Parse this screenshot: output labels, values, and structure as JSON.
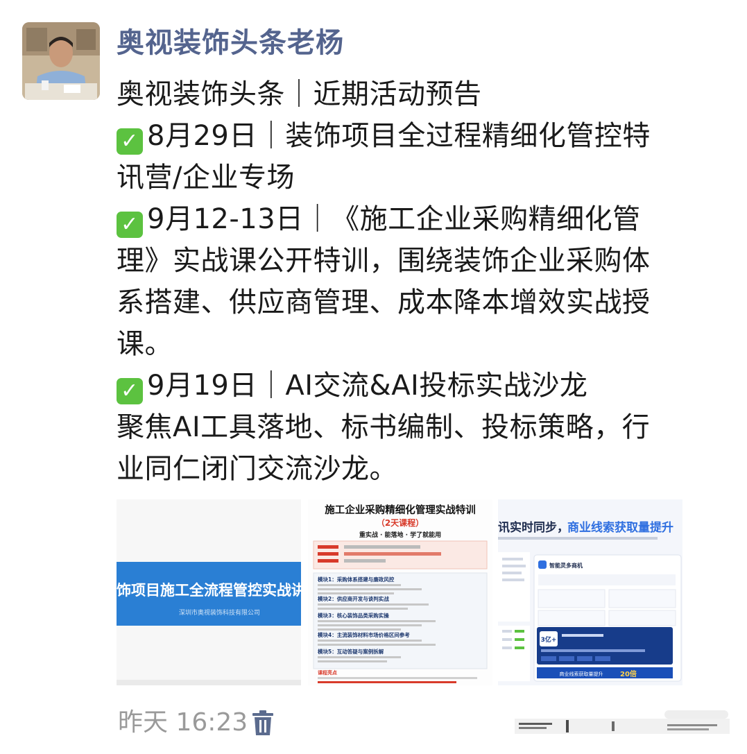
{
  "post": {
    "author": "奥视装饰头条老杨",
    "lines": [
      "奥视装饰头条｜近期活动预告",
      "8月29日｜装饰项目全过程精细化管控特",
      "讯营/企业专场",
      "9月12-13日｜《施工企业采购精细化管",
      "理》实战课公开特训，围绕装饰企业采购体",
      "系搭建、供应商管理、成本降本增效实战授",
      "课。",
      "9月19日｜AI交流&AI投标实战沙龙",
      "聚焦AI工具落地、标书编制、投标策略，行",
      "业同仁闭门交流沙龙。"
    ],
    "check_glyph": "✓",
    "timestamp": "昨天 16:23"
  },
  "images": {
    "img1": {
      "banner": "饰项目施工全流程管控实战讲",
      "company": "深圳市奥视装饰科技有限公司"
    },
    "img2": {
      "title": "施工企业采购精细化管理实战特训",
      "subtitle": "（2天课程）",
      "tagline": "重实战 · 能落地 · 学了就能用",
      "modules": [
        "模块1：采购体系搭建与廉政风控",
        "模块2：供应商开发与谈判实战",
        "模块3：核心装饰品类采购实操",
        "模块4：主流装饰材料市场价格区间参考",
        "模块5：互动答疑与案例拆解"
      ],
      "highlight_label": "课程亮点"
    },
    "img3": {
      "headline_a": "讯实时同步，",
      "headline_b": "商业线索获取量提升",
      "panel_title": "智能灵多商机",
      "badge": "3亿+",
      "bottom_bar": "商业线索获取量提升",
      "bottom_num": "20倍"
    }
  },
  "colors": {
    "author": "#54648e",
    "check": "#5cc240",
    "banner_blue": "#2a7fd4",
    "poster_red": "#d83a2a"
  }
}
